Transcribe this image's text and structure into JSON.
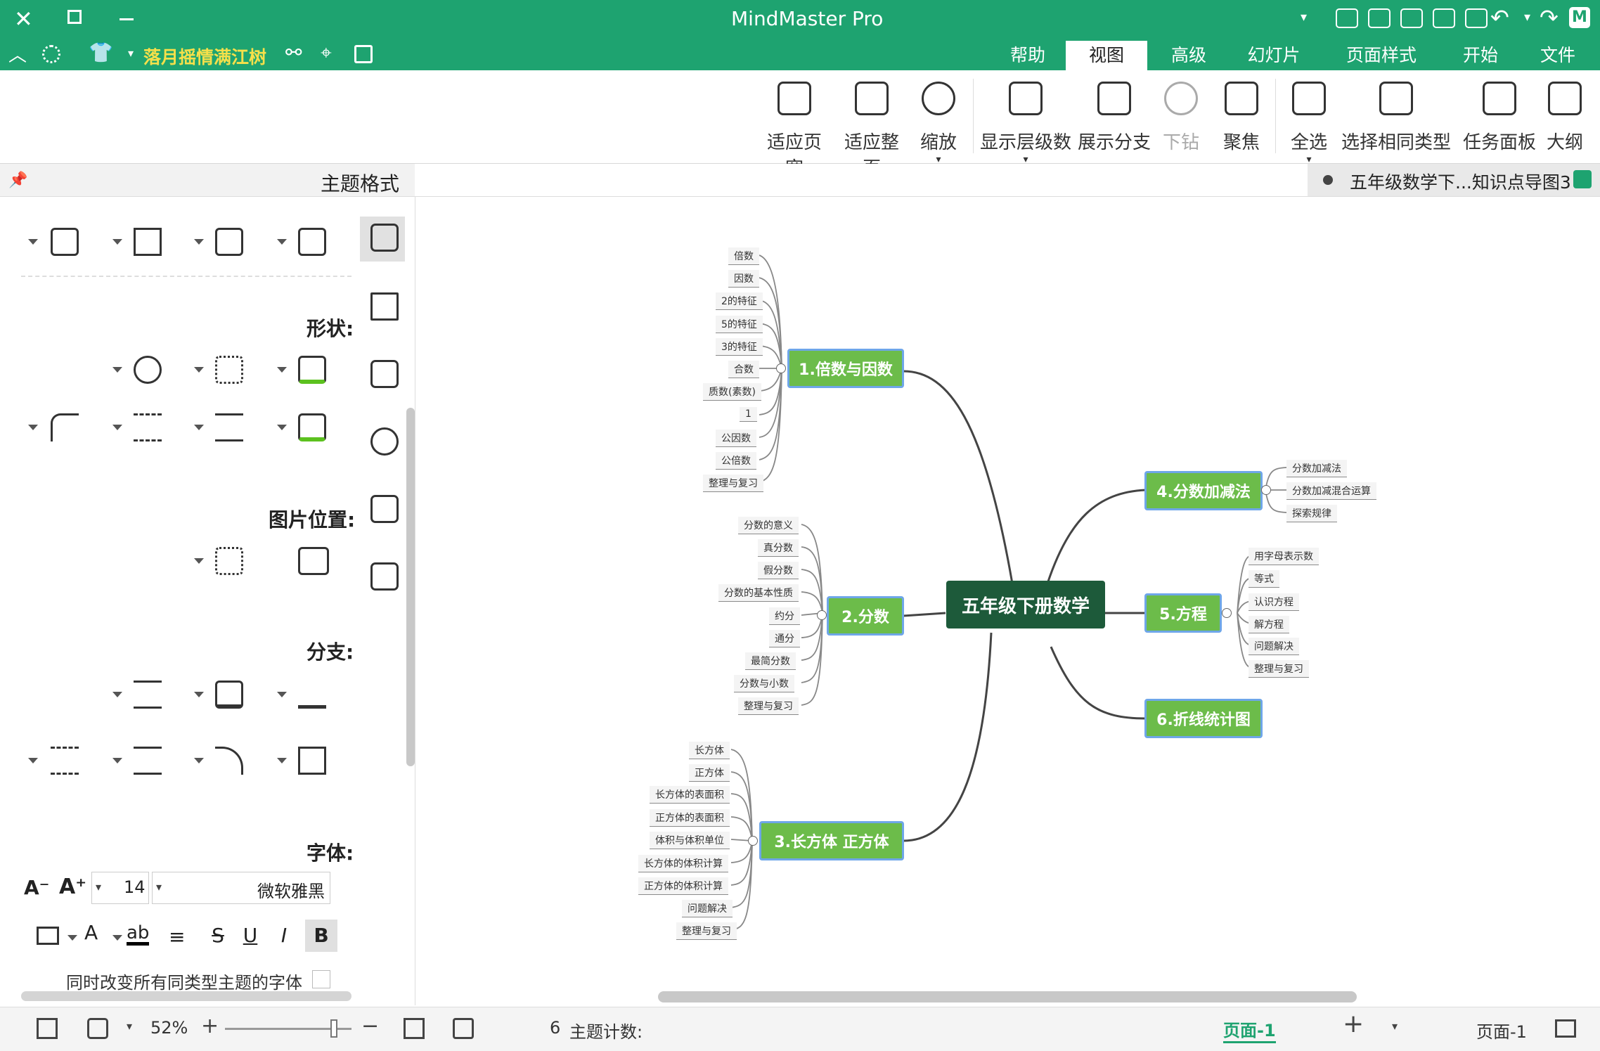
{
  "titlebar": {
    "title": "MindMaster Pro",
    "window_controls": [
      "close-icon",
      "maximize-icon",
      "minimize-icon"
    ],
    "quick_access_icons": [
      "caret-icon",
      "chevron-down-icon",
      "export-icon",
      "print-icon",
      "save-icon",
      "open-icon",
      "new-icon",
      "undo-icon",
      "chevron-down-icon",
      "redo-icon"
    ]
  },
  "menubar": {
    "tabs": [
      "帮助",
      "视图",
      "高级",
      "幻灯片",
      "页面样式",
      "开始",
      "文件"
    ],
    "active_tab": "视图",
    "user_name": "落月摇情满江树",
    "left_icons": [
      "collapse-icon",
      "apps-icon",
      "shirt-icon",
      "share-icon",
      "cursor-icon",
      "fullscreen-icon"
    ]
  },
  "ribbon": {
    "buttons": [
      {
        "label": "适应页宽",
        "icon": "fit-width-icon"
      },
      {
        "label": "适应整页",
        "icon": "fit-page-icon"
      },
      {
        "label": "缩放",
        "icon": "zoom-icon"
      },
      {
        "label": "显示层级数",
        "icon": "layers-icon"
      },
      {
        "label": "展示分支",
        "icon": "show-branch-icon"
      },
      {
        "label": "下钻",
        "icon": "drill-down-icon"
      },
      {
        "label": "聚焦",
        "icon": "focus-icon"
      },
      {
        "label": "全选",
        "icon": "select-all-icon"
      },
      {
        "label": "选择相同类型",
        "icon": "select-same-icon"
      },
      {
        "label": "任务面板",
        "icon": "task-panel-icon"
      },
      {
        "label": "大纲",
        "icon": "outline-icon"
      }
    ]
  },
  "panel": {
    "title": "主题格式",
    "sections": {
      "shape": "形状:",
      "image_position": "图片位置:",
      "branch": "分支:",
      "font": "字体:"
    },
    "font_name": "微软雅黑",
    "font_size": "14",
    "checkbox_label": "同时改变所有同类型主题的字体",
    "style_buttons": [
      "B",
      "I",
      "U",
      "S"
    ]
  },
  "doc_tab": {
    "title": "五年级数学下...知识点导图3"
  },
  "mindmap": {
    "central": "五年级下册数学",
    "topics": [
      {
        "label": "1.倍数与因数",
        "children": [
          "倍数",
          "因数",
          "2的特征",
          "5的特征",
          "3的特征",
          "合数",
          "质数(素数)",
          "1",
          "公因数",
          "公倍数",
          "整理与复习"
        ]
      },
      {
        "label": "2.分数",
        "children": [
          "分数的意义",
          "真分数",
          "假分数",
          "分数的基本性质",
          "约分",
          "通分",
          "最简分数",
          "分数与小数",
          "整理与复习"
        ]
      },
      {
        "label": "3.长方体  正方体",
        "children": [
          "长方体",
          "正方体",
          "长方体的表面积",
          "正方体的表面积",
          "体积与体积单位",
          "长方体的体积计算",
          "正方体的体积计算",
          "问题解决",
          "整理与复习"
        ]
      },
      {
        "label": "4.分数加减法",
        "children": [
          "分数加减法",
          "分数加减混合运算",
          "探索规律"
        ]
      },
      {
        "label": "5.方程",
        "children": [
          "用字母表示数",
          "等式",
          "认识方程",
          "解方程",
          "问题解决",
          "整理与复习"
        ]
      },
      {
        "label": "6.折线统计图",
        "children": []
      }
    ]
  },
  "statusbar": {
    "topic_count_label": "主题计数:",
    "topic_count": "6",
    "zoom": "52%",
    "page_tab": "页面-1",
    "page_tab_active": "页面-1"
  },
  "colors": {
    "brand": "#1ea370",
    "topic_fill": "#6cbc4a",
    "central_fill": "#1d5a3a",
    "topic_border": "#6ea6e8"
  }
}
